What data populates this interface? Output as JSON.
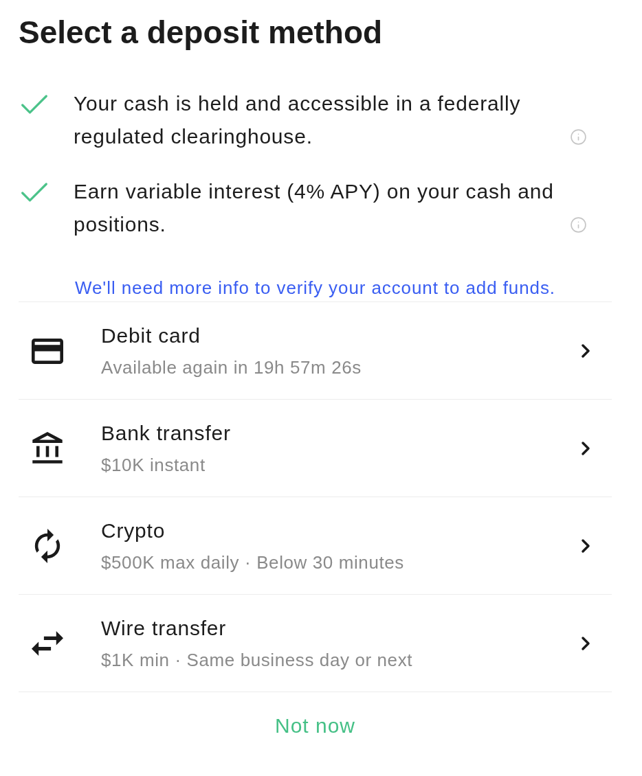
{
  "title": "Select a deposit method",
  "benefits": [
    {
      "text": "Your cash is held and accessible in a federally regulated clearinghouse.",
      "info": true
    },
    {
      "text": "Earn variable interest (4% APY) on your cash and positions.",
      "info": true
    }
  ],
  "verify_link": "We'll need more info to verify your account to add funds.",
  "methods": [
    {
      "kind": "card",
      "title": "Debit card",
      "subtitle": "Available again in 19h 57m 26s"
    },
    {
      "kind": "bank",
      "title": "Bank transfer",
      "subtitle": "$10K instant"
    },
    {
      "kind": "crypto",
      "title": "Crypto",
      "subtitle": "$500K max daily · Below 30 minutes"
    },
    {
      "kind": "wire",
      "title": "Wire transfer",
      "subtitle": "$1K min · Same business day or next"
    }
  ],
  "dismiss_button": "Not now"
}
